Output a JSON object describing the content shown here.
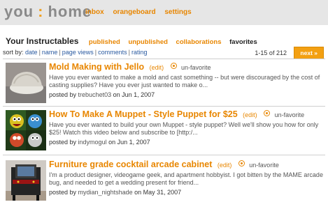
{
  "header": {
    "brand_left": "you",
    "brand_sep": ":",
    "brand_right": "home",
    "nav": [
      "inbox",
      "orangeboard",
      "settings"
    ]
  },
  "section": {
    "title": "Your Instructables",
    "tabs": [
      {
        "label": "published",
        "active": false
      },
      {
        "label": "unpublished",
        "active": false
      },
      {
        "label": "collaborations",
        "active": false
      },
      {
        "label": "favorites",
        "active": true
      }
    ]
  },
  "sort": {
    "prefix": "sort by:",
    "options": [
      "date",
      "name",
      "page views",
      "comments",
      "rating"
    ]
  },
  "pagination": {
    "range": "1-15 of 212",
    "next_label": "next »"
  },
  "items": [
    {
      "title": "Mold Making with Jello",
      "edit": "(edit)",
      "unfavorite": "un-favorite",
      "description": "Have you ever wanted to make a mold and cast something -- but were discouraged by the cost of casting supplies? Have you ever just wanted to make o...",
      "posted_by": "posted by",
      "author": "trebuchet03",
      "date": "on Jun 1, 2007"
    },
    {
      "title": "How To Make A Muppet - Style Puppet for $25",
      "edit": "(edit)",
      "unfavorite": "un-favorite",
      "description": "Have you ever wanted to build your own Muppet - style puppet? Well we'll show you how for only $25! Watch this video below and subscribe to [http:/...",
      "posted_by": "posted by",
      "author": "indymogul",
      "date": "on Jun 1, 2007"
    },
    {
      "title": "Furniture grade cocktail arcade cabinet",
      "edit": "(edit)",
      "unfavorite": "un-favorite",
      "description": "I'm a product designer, videogame geek, and apartment hobbyist. I got bitten by the MAME arcade bug, and needed to get a wedding present for friend...",
      "posted_by": "posted by",
      "author": "mydian_nightshade",
      "date": "on May 31, 2007"
    }
  ],
  "colors": {
    "accent": "#e88600",
    "header_bg": "#e6e6e6",
    "link_blue": "#2a5aa0"
  }
}
